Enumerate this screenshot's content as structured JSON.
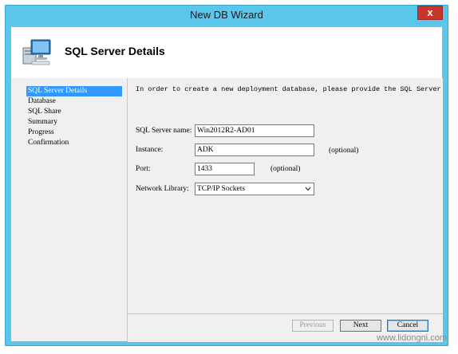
{
  "window": {
    "title": "New DB Wizard",
    "close_glyph": "x"
  },
  "header": {
    "title": "SQL Server Details",
    "icon": "computer-icon"
  },
  "nav": {
    "items": [
      {
        "label": "SQL Server Details",
        "active": true
      },
      {
        "label": "Database",
        "active": false
      },
      {
        "label": "SQL Share",
        "active": false
      },
      {
        "label": "Summary",
        "active": false
      },
      {
        "label": "Progress",
        "active": false
      },
      {
        "label": "Confirmation",
        "active": false
      }
    ]
  },
  "form": {
    "intro": "In order to create a new deployment database, please provide the SQL Server details ne",
    "server_name_label": "SQL Server name:",
    "server_name_value": "Win2012R2-AD01",
    "instance_label": "Instance:",
    "instance_value": "ADK",
    "instance_hint": "(optional)",
    "port_label": "Port:",
    "port_value": "1433",
    "port_hint": "(optional)",
    "network_library_label": "Network Library:",
    "network_library_value": "TCP/IP Sockets"
  },
  "footer": {
    "previous_label": "Previous",
    "next_label": "Next",
    "cancel_label": "Cancel"
  },
  "watermark": "www.lidongni.com",
  "colors": {
    "titlebar": "#5bc6ec",
    "close": "#c7352c",
    "nav_active": "#3399ff"
  }
}
